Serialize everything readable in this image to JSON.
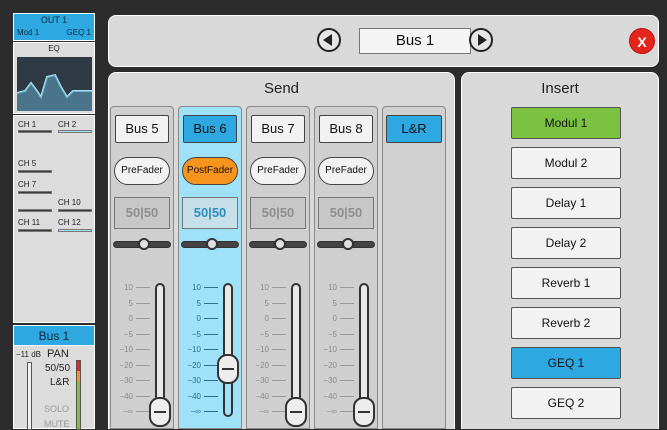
{
  "sidebar": {
    "out": {
      "title": "OUT 1",
      "left": "Mod 1",
      "right": "GEQ 1"
    },
    "eq_label": "EQ",
    "channels": [
      {
        "label": "CH 1"
      },
      {
        "label": "CH 2"
      },
      {
        "label": "CH 5"
      },
      {
        "label": "CH 7"
      },
      {
        "label": "CH 10"
      },
      {
        "label": "CH 11"
      },
      {
        "label": "CH 12"
      }
    ],
    "bus": {
      "title": "Bus 1",
      "level": "−11 dB",
      "pan_label": "PAN",
      "pan_value": "50/50",
      "routing": "L&R",
      "solo": "SOLO",
      "mute": "MUTE"
    }
  },
  "header": {
    "bus_name": "Bus 1",
    "close_label": "X"
  },
  "send": {
    "title": "Send",
    "strips": [
      {
        "bus": "Bus 5",
        "mode": "PreFader",
        "pan": "50|50",
        "active": false,
        "fader_level": 0.04,
        "scale": [
          "10",
          "5",
          "0",
          "−5",
          "−10",
          "−20",
          "−30",
          "−40",
          "−∞"
        ]
      },
      {
        "bus": "Bus 6",
        "mode": "PostFader",
        "pan": "50|50",
        "active": true,
        "fader_level": 0.36,
        "scale": [
          "10",
          "5",
          "0",
          "−5",
          "−10",
          "−20",
          "−30",
          "−40",
          "−∞"
        ]
      },
      {
        "bus": "Bus 7",
        "mode": "PreFader",
        "pan": "50|50",
        "active": false,
        "fader_level": 0.04,
        "scale": [
          "10",
          "5",
          "0",
          "−5",
          "−10",
          "−20",
          "−30",
          "−40",
          "−∞"
        ]
      },
      {
        "bus": "Bus 8",
        "mode": "PreFader",
        "pan": "50|50",
        "active": false,
        "fader_level": 0.04,
        "scale": [
          "10",
          "5",
          "0",
          "−5",
          "−10",
          "−20",
          "−30",
          "−40",
          "−∞"
        ]
      }
    ],
    "lr_label": "L&R"
  },
  "insert": {
    "title": "Insert",
    "items": [
      {
        "label": "Modul 1",
        "state": "green"
      },
      {
        "label": "Modul 2",
        "state": "off"
      },
      {
        "label": "Delay 1",
        "state": "off"
      },
      {
        "label": "Delay 2",
        "state": "off"
      },
      {
        "label": "Reverb 1",
        "state": "off"
      },
      {
        "label": "Reverb 2",
        "state": "off"
      },
      {
        "label": "GEQ 1",
        "state": "blue"
      },
      {
        "label": "GEQ 2",
        "state": "off"
      }
    ]
  },
  "colors": {
    "accent_blue": "#2ea8e0",
    "accent_orange": "#f7941d",
    "accent_green": "#7cc242",
    "close_red": "#e4251e"
  }
}
